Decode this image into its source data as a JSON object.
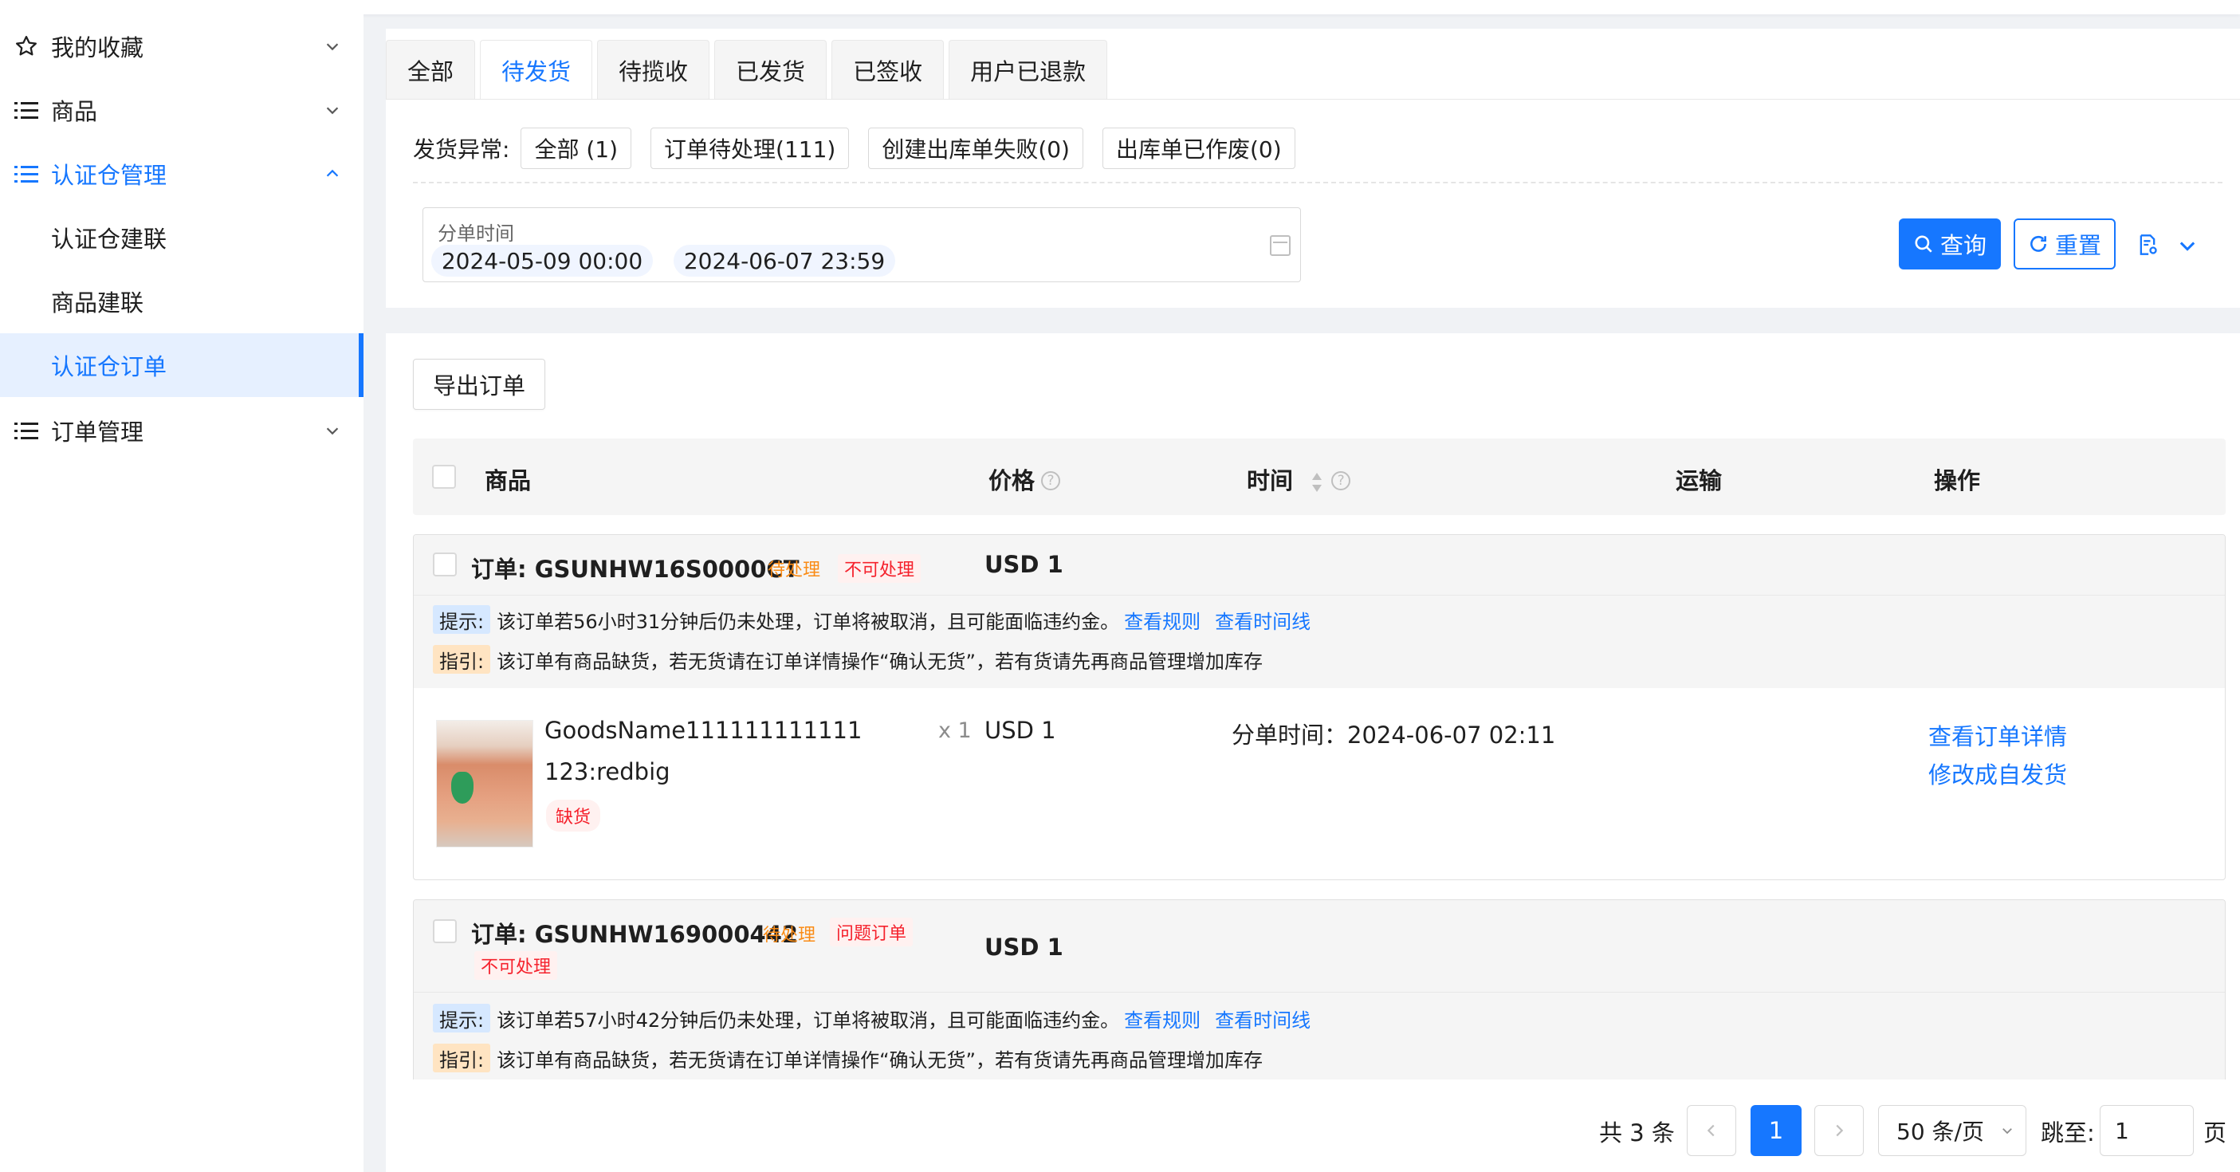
{
  "sidebar": {
    "items": [
      {
        "label": "我的收藏"
      },
      {
        "label": "商品"
      },
      {
        "label": "认证仓管理"
      },
      {
        "label": "认证仓建联"
      },
      {
        "label": "商品建联"
      },
      {
        "label": "认证仓订单"
      },
      {
        "label": "订单管理"
      }
    ]
  },
  "tabs": [
    "全部",
    "待发货",
    "待揽收",
    "已发货",
    "已签收",
    "用户已退款"
  ],
  "exceptions": {
    "label": "发货异常:",
    "chips": [
      "全部 (1)",
      "订单待处理(111)",
      "创建出库单失败(0)",
      "出库单已作废(0)"
    ]
  },
  "date_filter": {
    "title": "分单时间",
    "start": "2024-05-09 00:00",
    "separator": "~",
    "end": "2024-06-07 23:59"
  },
  "actions": {
    "query": "查询",
    "reset": "重置"
  },
  "export_label": "导出订单",
  "table_header": {
    "goods": "商品",
    "price": "价格",
    "time": "时间",
    "shipping": "运输",
    "ops": "操作"
  },
  "orders": [
    {
      "order_no": "订单: GSUNHW16S0000CT",
      "tags": [
        "待处理",
        "不可处理"
      ],
      "price": "USD 1",
      "tip_label": "提示:",
      "tip_text": "该订单若56小时31分钟后仍未处理，订单将被取消，且可能面临违约金。",
      "tip_link1": "查看规则",
      "tip_link2": "查看时间线",
      "guide_label": "指引:",
      "guide_text": "该订单有商品缺货，若无货请在订单详情操作“确认无货”，若有货请先再商品管理增加库存",
      "goods_name": "GoodsName111111111111",
      "goods_spec": "123:redbig",
      "stock_tag": "缺货",
      "qty": "x 1",
      "goods_price": "USD 1",
      "split_time": "分单时间：2024-06-07 02:11",
      "op1": "查看订单详情",
      "op2": "修改成自发货"
    },
    {
      "order_no": "订单: GSUNHW169000442",
      "tags": [
        "待处理",
        "问题订单",
        "不可处理"
      ],
      "price": "USD 1",
      "tip_label": "提示:",
      "tip_text": "该订单若57小时42分钟后仍未处理，订单将被取消，且可能面临违约金。",
      "tip_link1": "查看规则",
      "tip_link2": "查看时间线",
      "guide_label": "指引:",
      "guide_text": "该订单有商品缺货，若无货请在订单详情操作“确认无货”，若有货请先再商品管理增加库存"
    }
  ],
  "pagination": {
    "total": "共 3 条",
    "current": "1",
    "page_size": "50 条/页",
    "jump_label": "跳至:",
    "jump_value": "1",
    "page_suffix": "页"
  },
  "colors": {
    "primary": "#1677ff",
    "warning": "#fa8c16",
    "danger": "#f5222d"
  }
}
